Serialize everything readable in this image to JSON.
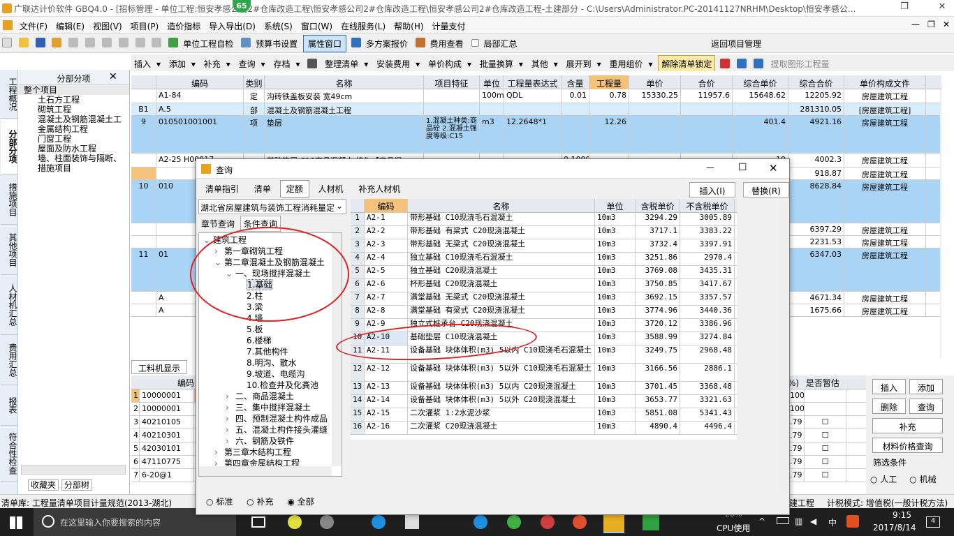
{
  "window": {
    "title": "广联达计价软件 GBQ4.0 - [招标管理 - 单位工程:恒安孝感公司2#仓库改造工程\\恒安孝感公司2#仓库改造工程\\恒安孝感公司2#仓库改造工程-土建部分 - C:\\Users\\Administrator.PC-20141127NRHM\\Desktop\\恒安孝感公...",
    "badge": "65"
  },
  "menu": [
    "文件(F)",
    "编辑(E)",
    "视图(V)",
    "项目(P)",
    "造价指标",
    "导入导出(D)",
    "系统(S)",
    "窗口(W)",
    "在线服务(L)",
    "帮助(H)",
    "计量支付"
  ],
  "toolbar1": [
    "单位工程自检",
    "预算书设置",
    "属性窗口",
    "多方案报价",
    "费用查看",
    "局部汇总",
    "返回项目管理"
  ],
  "toolbar2": [
    "插入",
    "添加",
    "补充",
    "查询",
    "存档",
    "整理清单",
    "安装费用",
    "单价构成",
    "批量换算",
    "其他",
    "展开到",
    "重用组价",
    "解除清单锁定",
    "提取图形工程量"
  ],
  "vtabs": [
    "工程概况",
    "分部分项",
    "措施项目",
    "其他项目",
    "人材机汇总",
    "费用汇总",
    "报表",
    "符合性检查"
  ],
  "tree": {
    "title": "分部分项",
    "items": [
      "整个项目",
      "土石方工程",
      "砌筑工程",
      "混凝土及钢筋混凝土工",
      "金属结构工程",
      "门窗工程",
      "屋面及防水工程",
      "墙、柱面装饰与隔断、",
      "措施项目"
    ],
    "bottom_tabs": [
      "收藏夹",
      "分部树"
    ]
  },
  "grid": {
    "headers": [
      "编码",
      "类别",
      "名称",
      "项目特征",
      "单位",
      "工程量表达式",
      "含量",
      "工程量",
      "单价",
      "合价",
      "综合单价",
      "综合合价",
      "单价构成文件"
    ],
    "rows": [
      {
        "no": "",
        "code": "A1-84",
        "type": "定",
        "name": "沟砖铁盖板安装 宽49cm",
        "feat": "",
        "unit": "100m",
        "expr": "QDL",
        "content": "0.01",
        "qty": "0.78",
        "price": "15330.25",
        "total": "11957.6",
        "cprice": "15648.62",
        "ctotal": "12205.92",
        "file": "房屋建筑工程"
      },
      {
        "no": "B1",
        "code": "A.5",
        "type": "部",
        "name": "混凝土及钢筋混凝土工程",
        "feat": "",
        "unit": "",
        "expr": "",
        "content": "",
        "qty": "",
        "price": "",
        "total": "",
        "cprice": "",
        "ctotal": "281310.05",
        "file": "[房屋建筑工程]"
      },
      {
        "no": "9",
        "code": "010501001001",
        "type": "项",
        "name": "垫层",
        "feat": "1.混凝土种类:商品砼 2.混凝土强度等级:C15",
        "unit": "m3",
        "expr": "12.2648*1",
        "content": "",
        "qty": "12.26",
        "price": "",
        "total": "",
        "cprice": "401.4",
        "ctotal": "4921.16",
        "file": "房屋建筑工程"
      },
      {
        "no": "",
        "code": "A2-25 H00017",
        "type": "",
        "name": "基础垫层 C10商品混凝土 换为【商品混",
        "feat": "",
        "unit": "",
        "expr": "",
        "content": "0.1000",
        "qty": "",
        "price": "",
        "total": "",
        "cprice": "19",
        "ctotal": "4002.3",
        "file": "房屋建筑工程"
      },
      {
        "no": "",
        "code": "",
        "type": "",
        "name": "",
        "feat": "",
        "unit": "",
        "expr": "",
        "content": "",
        "qty": "",
        "price": "",
        "total": "",
        "cprice": "",
        "ctotal": "918.87",
        "file": "房屋建筑工程"
      },
      {
        "no": "10",
        "code": "010",
        "type": "",
        "name": "",
        "feat": "",
        "unit": "",
        "expr": "",
        "content": "",
        "qty": "",
        "price": "",
        "total": "",
        "cprice": "09",
        "ctotal": "8628.84",
        "file": "房屋建筑工程"
      },
      {
        "no": "",
        "code": "",
        "type": "",
        "name": "",
        "feat": "",
        "unit": "",
        "expr": "",
        "content": "",
        "qty": "",
        "price": "",
        "total": "",
        "cprice": "",
        "ctotal": "6397.29",
        "file": "房屋建筑工程"
      },
      {
        "no": "",
        "code": "",
        "type": "",
        "name": "",
        "feat": "",
        "unit": "",
        "expr": "",
        "content": "",
        "qty": "",
        "price": "",
        "total": "",
        "cprice": "42",
        "ctotal": "2231.53",
        "file": "房屋建筑工程"
      },
      {
        "no": "11",
        "code": "01",
        "type": "",
        "name": "",
        "feat": "",
        "unit": "",
        "expr": "",
        "content": "",
        "qty": "",
        "price": "",
        "total": "",
        "cprice": "15",
        "ctotal": "6347.03",
        "file": "房屋建筑工程"
      },
      {
        "no": "",
        "code": "A",
        "type": "",
        "name": "",
        "feat": "",
        "unit": "",
        "expr": "",
        "content": "",
        "qty": "",
        "price": "",
        "total": "",
        "cprice": "25",
        "ctotal": "4671.34",
        "file": "房屋建筑工程"
      },
      {
        "no": "",
        "code": "A",
        "type": "",
        "name": "",
        "feat": "",
        "unit": "",
        "expr": "",
        "content": "",
        "qty": "",
        "price": "",
        "total": "",
        "cprice": "61",
        "ctotal": "1675.66",
        "file": "房屋建筑工程"
      }
    ]
  },
  "bottom": {
    "tab": "工料机显示",
    "header": "编码",
    "rows": [
      {
        "n": "1",
        "code": "10000001"
      },
      {
        "n": "2",
        "code": "10000001"
      },
      {
        "n": "3",
        "code": "40210105"
      },
      {
        "n": "4",
        "code": "40210301"
      },
      {
        "n": "5",
        "code": "42030101"
      },
      {
        "n": "6",
        "code": "47110775"
      },
      {
        "n": "7",
        "code": "6-20@1"
      }
    ],
    "right_header": [
      "%)",
      "是否暂估"
    ],
    "right_vals": [
      "100",
      "100",
      ".79",
      ".79",
      ".79",
      ".79",
      ".79"
    ],
    "buttons": [
      "插入",
      "添加",
      "删除",
      "查询",
      "补充",
      "材料价格查询"
    ],
    "filter": {
      "label": "筛选条件",
      "opt1": "人工",
      "opt2": "机械"
    }
  },
  "status": {
    "left": "清单库: 工程量清单项目计量规范(2013-湖北)",
    "mid": "建工程",
    "right": "计税模式: 增值税(一般计税方法)"
  },
  "taskbar": {
    "search": "在这里输入你要搜索的内容",
    "cpu_pct": "26%",
    "cpu_label": "CPU使用",
    "time": "9:15",
    "date": "2017/8/14",
    "ime": "中",
    "notif": "4"
  },
  "dialog": {
    "title": "查询",
    "tabs": [
      "清单指引",
      "清单",
      "定额",
      "人材机",
      "补充人材机"
    ],
    "btn_insert": "插入(I)",
    "btn_replace": "替换(R)",
    "library": "湖北省房屋建筑与装饰工程消耗量定",
    "subtabs": [
      "章节查询",
      "条件查询"
    ],
    "tree": [
      {
        "lvl": 0,
        "sym": "⌄",
        "text": "建筑工程"
      },
      {
        "lvl": 1,
        "sym": "›",
        "text": "第一章砌筑工程"
      },
      {
        "lvl": 1,
        "sym": "⌄",
        "text": "第二章混凝土及钢筋混凝土"
      },
      {
        "lvl": 2,
        "sym": "⌄",
        "text": "一、现场搅拌混凝土"
      },
      {
        "lvl": 3,
        "sym": "",
        "text": "1.基础",
        "sel": true
      },
      {
        "lvl": 3,
        "sym": "",
        "text": "2.柱"
      },
      {
        "lvl": 3,
        "sym": "",
        "text": "3.梁"
      },
      {
        "lvl": 3,
        "sym": "",
        "text": "4.墙"
      },
      {
        "lvl": 3,
        "sym": "",
        "text": "5.板"
      },
      {
        "lvl": 3,
        "sym": "",
        "text": "6.楼梯"
      },
      {
        "lvl": 3,
        "sym": "",
        "text": "7.其他构件"
      },
      {
        "lvl": 3,
        "sym": "",
        "text": "8.明沟、散水"
      },
      {
        "lvl": 3,
        "sym": "",
        "text": "9.坡道、电缆沟"
      },
      {
        "lvl": 3,
        "sym": "",
        "text": "10.检查井及化粪池"
      },
      {
        "lvl": 2,
        "sym": "›",
        "text": "二、商品混凝土"
      },
      {
        "lvl": 2,
        "sym": "›",
        "text": "三、集中搅拌混凝土"
      },
      {
        "lvl": 2,
        "sym": "›",
        "text": "四、预制混凝土构件成品"
      },
      {
        "lvl": 2,
        "sym": "›",
        "text": "五、混凝土构件接头灌缝"
      },
      {
        "lvl": 2,
        "sym": "›",
        "text": "六、钢筋及铁件"
      },
      {
        "lvl": 1,
        "sym": "›",
        "text": "第三章木结构工程"
      },
      {
        "lvl": 1,
        "sym": "›",
        "text": "第四章金属结构工程"
      },
      {
        "lvl": 1,
        "sym": "›",
        "text": "第五章屋面及防水工程"
      }
    ],
    "radios": [
      "标准",
      "补充",
      "全部"
    ],
    "table_headers": [
      "编码",
      "名称",
      "单位",
      "含税单价",
      "不含税单价"
    ],
    "rows": [
      {
        "n": "1",
        "code": "A2-1",
        "name": "带形基础 C10现浇毛石混凝土",
        "unit": "10m3",
        "p1": "3294.29",
        "p2": "3005.89"
      },
      {
        "n": "2",
        "code": "A2-2",
        "name": "带形基础 有梁式 C20现浇混凝土",
        "unit": "10m3",
        "p1": "3717.1",
        "p2": "3383.22"
      },
      {
        "n": "3",
        "code": "A2-3",
        "name": "带形基础 无梁式 C20现浇混凝土",
        "unit": "10m3",
        "p1": "3732.4",
        "p2": "3397.91"
      },
      {
        "n": "4",
        "code": "A2-4",
        "name": "独立基础 C10现浇毛石混凝土",
        "unit": "10m3",
        "p1": "3251.86",
        "p2": "2970.4"
      },
      {
        "n": "5",
        "code": "A2-5",
        "name": "独立基础 C20现浇混凝土",
        "unit": "10m3",
        "p1": "3769.08",
        "p2": "3435.31"
      },
      {
        "n": "6",
        "code": "A2-6",
        "name": "杯形基础 C20现浇混凝土",
        "unit": "10m3",
        "p1": "3750.85",
        "p2": "3417.67"
      },
      {
        "n": "7",
        "code": "A2-7",
        "name": "满堂基础 无梁式 C20现浇混凝土",
        "unit": "10m3",
        "p1": "3692.15",
        "p2": "3357.57"
      },
      {
        "n": "8",
        "code": "A2-8",
        "name": "满堂基础 有梁式 C20现浇混凝土",
        "unit": "10m3",
        "p1": "3774.96",
        "p2": "3440.36"
      },
      {
        "n": "9",
        "code": "A2-9",
        "name": "独立式桩承台 C20现浇混凝土",
        "unit": "10m3",
        "p1": "3720.12",
        "p2": "3386.96"
      },
      {
        "n": "10",
        "code": "A2-10",
        "name": "基础垫层 C10现浇混凝土",
        "unit": "10m3",
        "p1": "3588.99",
        "p2": "3274.84"
      },
      {
        "n": "11",
        "code": "A2-11",
        "name": "设备基础 块体体积(m3) 5以内 C10现浇毛石混凝土",
        "unit": "10m3",
        "p1": "3249.75",
        "p2": "2968.48"
      },
      {
        "n": "12",
        "code": "A2-12",
        "name": "设备基础 块体体积(m3) 5以外 C10现浇毛石混凝土",
        "unit": "10m3",
        "p1": "3166.56",
        "p2": "2886.1"
      },
      {
        "n": "13",
        "code": "A2-13",
        "name": "设备基础 块体体积(m3) 5以内 C20现浇混凝土",
        "unit": "10m3",
        "p1": "3701.45",
        "p2": "3368.48"
      },
      {
        "n": "14",
        "code": "A2-14",
        "name": "设备基础 块体体积(m3) 5以外 C20现浇混凝土",
        "unit": "10m3",
        "p1": "3653.77",
        "p2": "3321.63"
      },
      {
        "n": "15",
        "code": "A2-15",
        "name": "二次灌浆 1:2水泥沙浆",
        "unit": "10m3",
        "p1": "5851.08",
        "p2": "5341.43"
      },
      {
        "n": "16",
        "code": "A2-16",
        "name": "二次灌浆 C20现浇混凝土",
        "unit": "10m3",
        "p1": "4890.4",
        "p2": "4496.4"
      }
    ]
  }
}
